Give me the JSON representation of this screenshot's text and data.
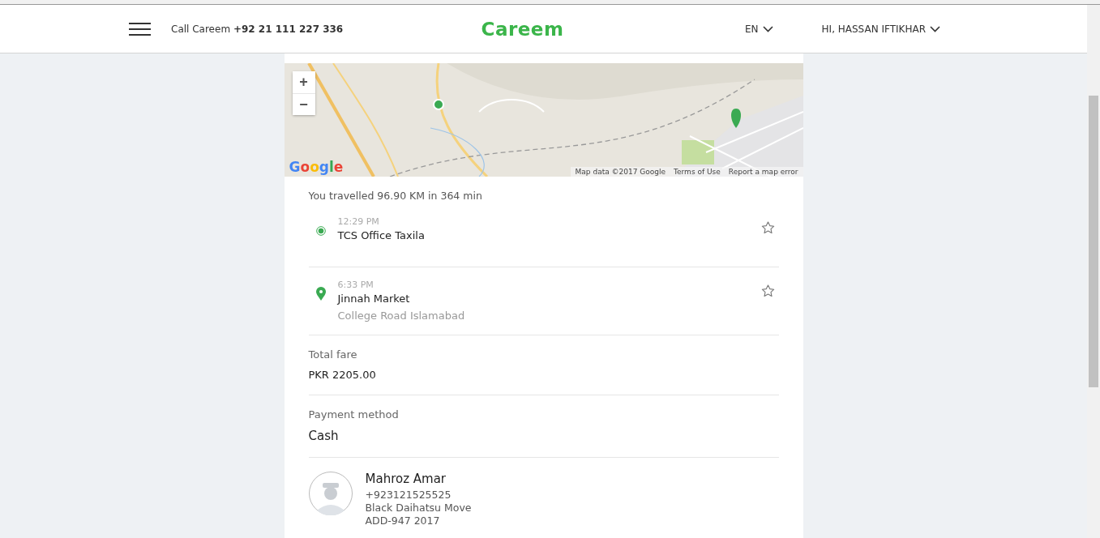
{
  "header": {
    "call_label": "Call Careem",
    "phone": "+92 21 111 227 336",
    "logo": "Careem",
    "language": "EN",
    "user": "HI, HASSAN IFTIKHAR"
  },
  "map": {
    "kind": "picture",
    "zoom_in": "+",
    "zoom_out": "−",
    "logo": "Google",
    "attribution": [
      "Map data ©2017 Google",
      "Terms of Use",
      "Report a map error"
    ]
  },
  "trip_summary": "You travelled 96.90 KM in 364 min",
  "stops": [
    {
      "kind": "pickup",
      "time": "12:29 PM",
      "name": "TCS Office Taxila"
    },
    {
      "kind": "dropoff",
      "time": "6:33 PM",
      "name": "Jinnah Market",
      "address": "College Road Islamabad"
    }
  ],
  "fare": {
    "label": "Total fare",
    "value": "PKR 2205.00"
  },
  "payment": {
    "label": "Payment method",
    "value": "Cash"
  },
  "driver": {
    "name": "Mahroz Amar",
    "phone": "+923121525525",
    "car": "Black Daihatsu Move",
    "plate": "ADD-947 2017"
  }
}
